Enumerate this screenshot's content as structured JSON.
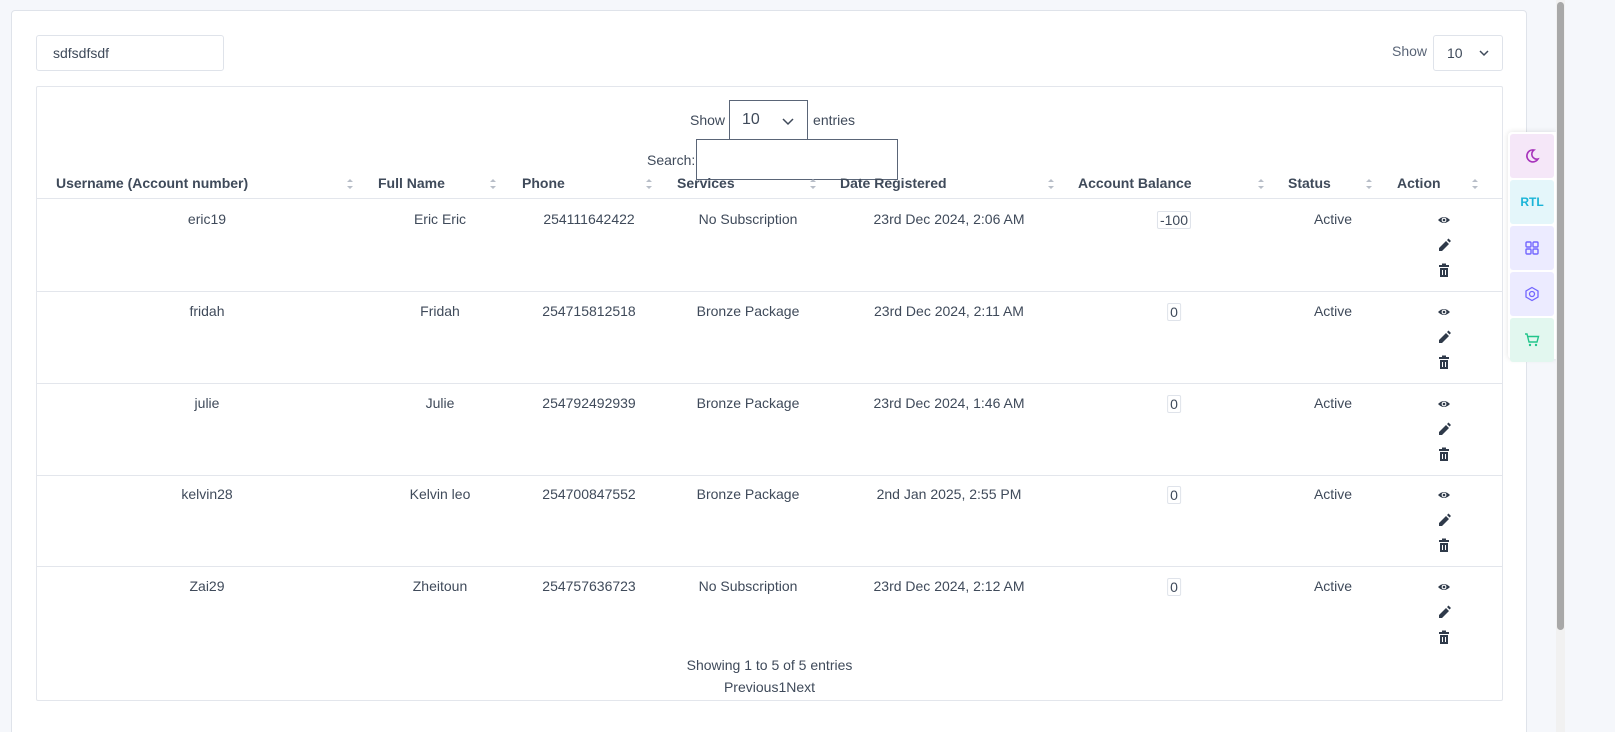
{
  "filters": {
    "search_value": "sdfsdfsdf",
    "show_label": "Show",
    "show_value": "10"
  },
  "table_controls": {
    "show_label": "Show",
    "show_value": "10",
    "entries_label": "entries",
    "search_label": "Search:"
  },
  "columns": [
    "Username (Account number)",
    "Full Name",
    "Phone",
    "Services",
    "Date Registered",
    "Account Balance",
    "Status",
    "Action"
  ],
  "rows": [
    {
      "username": "eric19",
      "full_name": "Eric Eric",
      "phone": "254111642422",
      "service": "No Subscription",
      "date": "23rd Dec 2024, 2:06 AM",
      "balance": "-100",
      "status": "Active"
    },
    {
      "username": "fridah",
      "full_name": "Fridah",
      "phone": "254715812518",
      "service": "Bronze Package",
      "date": "23rd Dec 2024, 2:11 AM",
      "balance": "0",
      "status": "Active"
    },
    {
      "username": "julie",
      "full_name": "Julie",
      "phone": "254792492939",
      "service": "Bronze Package",
      "date": "23rd Dec 2024, 1:46 AM",
      "balance": "0",
      "status": "Active"
    },
    {
      "username": "kelvin28",
      "full_name": "Kelvin leo",
      "phone": "254700847552",
      "service": "Bronze Package",
      "date": "2nd Jan 2025, 2:55 PM",
      "balance": "0",
      "status": "Active"
    },
    {
      "username": "Zai29",
      "full_name": "Zheitoun",
      "phone": "254757636723",
      "service": "No Subscription",
      "date": "23rd Dec 2024, 2:12 AM",
      "balance": "0",
      "status": "Active"
    }
  ],
  "footer": {
    "info": "Showing 1 to 5 of 5 entries",
    "previous": "Previous",
    "page": "1",
    "next": "Next"
  },
  "side_rail": {
    "items": [
      "moon-icon",
      "RTL",
      "grid-icon",
      "layers-icon",
      "cart-icon"
    ],
    "rtl_label": "RTL",
    "colors": {
      "moon": "#a733bb",
      "rtl": "#1ab4d7",
      "grid": "#7366ff",
      "layers": "#7366ff",
      "cart": "#22c58b"
    }
  }
}
